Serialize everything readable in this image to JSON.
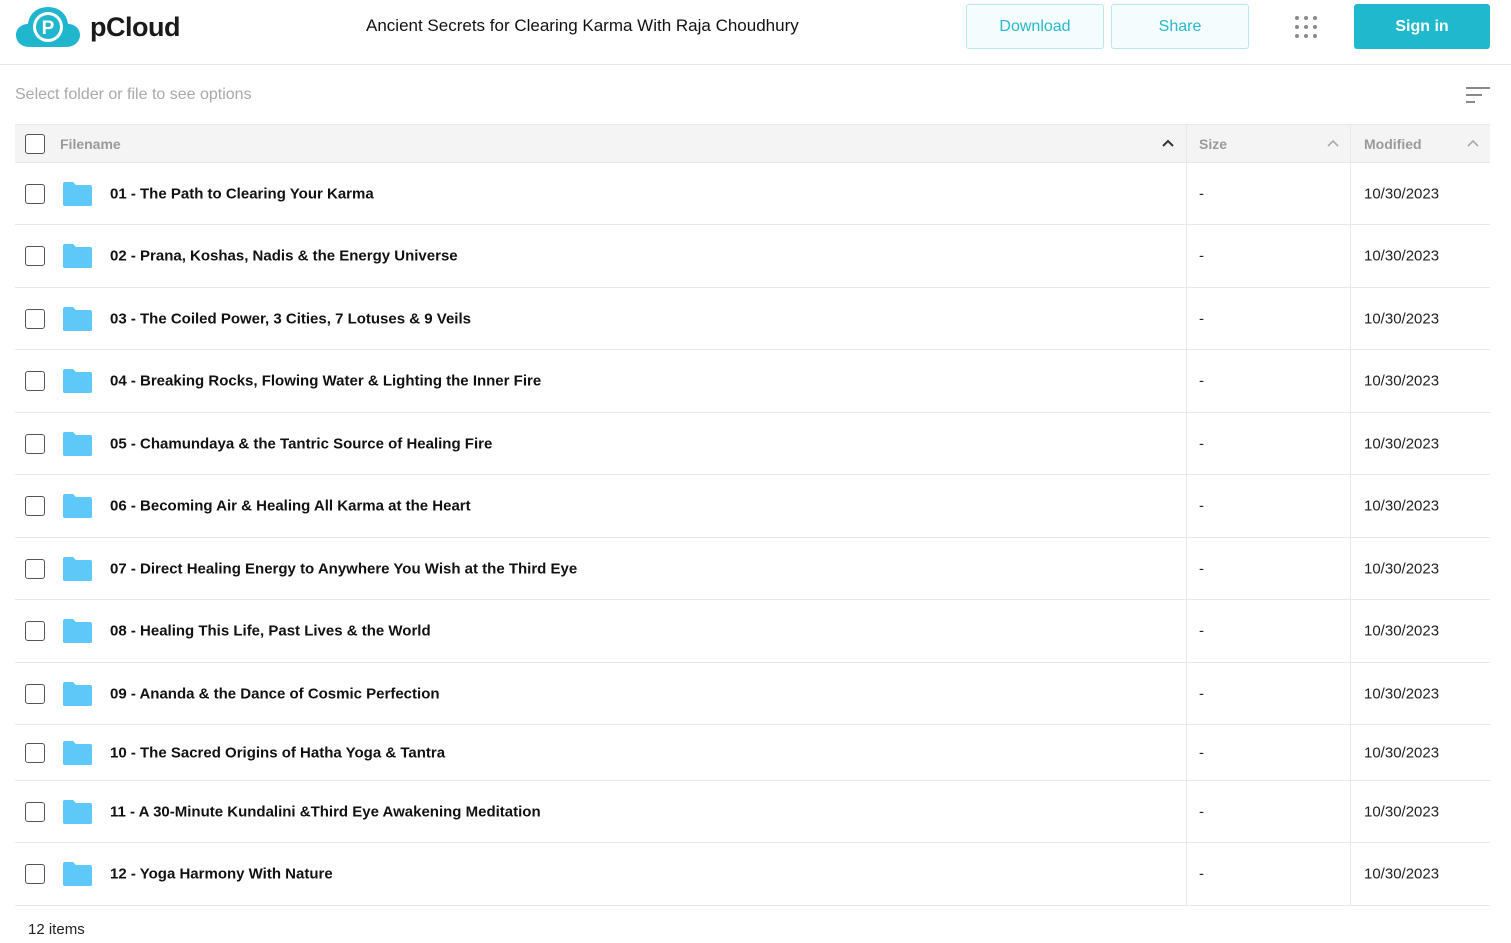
{
  "brand": {
    "name": "pCloud",
    "logo_letter": "P",
    "accent": "#1fb8cc"
  },
  "header": {
    "title": "Ancient Secrets for Clearing Karma With Raja Choudhury",
    "download_label": "Download",
    "share_label": "Share",
    "signin_label": "Sign in",
    "apps_icon": "grid-icon"
  },
  "toolbar": {
    "hint": "Select folder or file to see options",
    "sort_icon": "sort-icon"
  },
  "table": {
    "columns": {
      "filename": "Filename",
      "size": "Size",
      "modified": "Modified"
    },
    "rows": [
      {
        "name": "01 - The Path to Clearing Your Karma",
        "size": "-",
        "modified": "10/30/2023"
      },
      {
        "name": "02 - Prana, Koshas, Nadis & the Energy Universe",
        "size": "-",
        "modified": "10/30/2023"
      },
      {
        "name": "03 - The Coiled Power, 3 Cities, 7 Lotuses & 9 Veils",
        "size": "-",
        "modified": "10/30/2023"
      },
      {
        "name": "04 - Breaking Rocks, Flowing Water & Lighting the Inner Fire",
        "size": "-",
        "modified": "10/30/2023"
      },
      {
        "name": "05 - Chamundaya & the Tantric Source of Healing Fire",
        "size": "-",
        "modified": "10/30/2023"
      },
      {
        "name": "06 - Becoming Air & Healing All Karma at the Heart",
        "size": "-",
        "modified": "10/30/2023"
      },
      {
        "name": "07 - Direct Healing Energy to Anywhere You Wish at the Third Eye",
        "size": "-",
        "modified": "10/30/2023"
      },
      {
        "name": "08 - Healing This Life, Past Lives & the World",
        "size": "-",
        "modified": "10/30/2023"
      },
      {
        "name": "09 - Ananda & the Dance of Cosmic Perfection",
        "size": "-",
        "modified": "10/30/2023"
      },
      {
        "name": "10 - The Sacred Origins of Hatha Yoga & Tantra",
        "size": "-",
        "modified": "10/30/2023"
      },
      {
        "name": "11 - A 30-Minute Kundalini &Third Eye Awakening Meditation",
        "size": "-",
        "modified": "10/30/2023"
      },
      {
        "name": "12 - Yoga Harmony With Nature",
        "size": "-",
        "modified": "10/30/2023"
      }
    ]
  },
  "footer": {
    "count": "12 items"
  },
  "colors": {
    "folder": "#5ec8f8",
    "accent_light": "#f4fcfd",
    "accent_border": "#b9e8ef"
  }
}
